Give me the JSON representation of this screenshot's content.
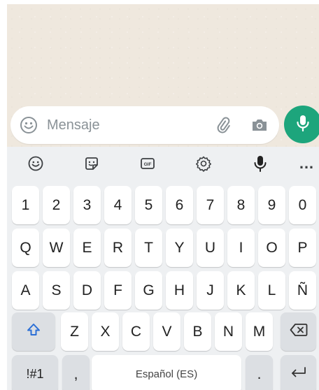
{
  "composer": {
    "placeholder": "Mensaje"
  },
  "toolbar": {
    "items": [
      "emoji-icon",
      "sticker-icon",
      "gif-icon",
      "settings-icon",
      "microphone-icon",
      "more-icon"
    ],
    "gif_label": "GIF",
    "more_label": "…"
  },
  "keyboard": {
    "row_numbers": [
      "1",
      "2",
      "3",
      "4",
      "5",
      "6",
      "7",
      "8",
      "9",
      "0"
    ],
    "row_1": [
      "Q",
      "W",
      "E",
      "R",
      "T",
      "Y",
      "U",
      "I",
      "O",
      "P"
    ],
    "row_2": [
      "A",
      "S",
      "D",
      "F",
      "G",
      "H",
      "J",
      "K",
      "L",
      "Ñ"
    ],
    "row_3": [
      "Z",
      "X",
      "C",
      "V",
      "B",
      "N",
      "M"
    ],
    "symbols_label": "!#1",
    "comma_label": ",",
    "space_label": "Español (ES)",
    "period_label": "."
  },
  "colors": {
    "accent": "#1da57c",
    "shift_icon": "#2b6fd6",
    "chat_background": "#efe8de",
    "keyboard_background": "#eef0f2"
  }
}
